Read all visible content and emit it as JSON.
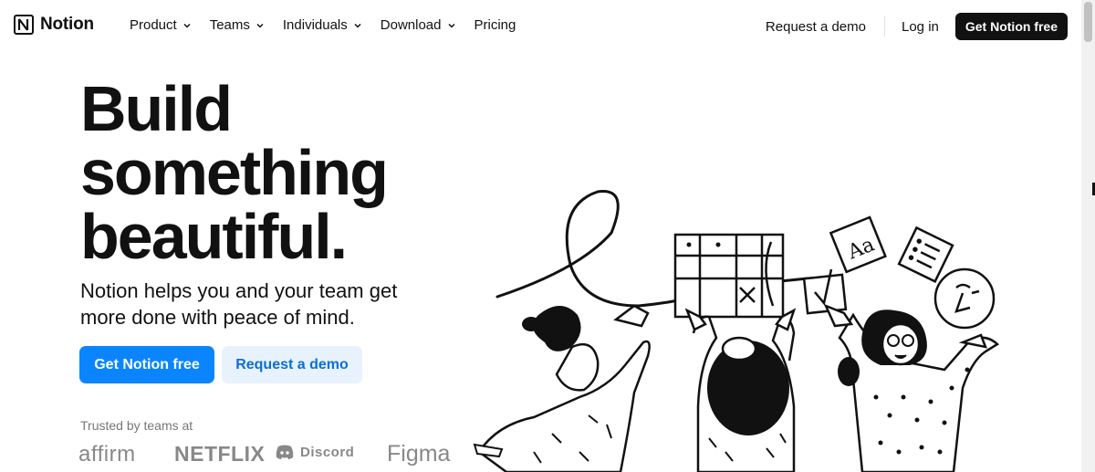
{
  "brand": {
    "name": "Notion"
  },
  "nav": {
    "items": [
      {
        "label": "Product",
        "dropdown": true
      },
      {
        "label": "Teams",
        "dropdown": true
      },
      {
        "label": "Individuals",
        "dropdown": true
      },
      {
        "label": "Download",
        "dropdown": true
      },
      {
        "label": "Pricing",
        "dropdown": false
      }
    ],
    "request_demo": "Request a demo",
    "login": "Log in",
    "cta": "Get Notion free"
  },
  "hero": {
    "title_lines": [
      "Build",
      "something",
      "beautiful."
    ],
    "subtitle": "Notion helps you and your team get more done with peace of mind.",
    "primary_button": "Get Notion free",
    "secondary_button": "Request a demo",
    "trusted_label": "Trusted by teams at",
    "logos": [
      "affirm",
      "NETFLIX",
      "Discord",
      "Figma"
    ]
  },
  "colors": {
    "primary": "#0a85ff",
    "secondary_bg": "#e8f2fd",
    "dark": "#111111"
  }
}
